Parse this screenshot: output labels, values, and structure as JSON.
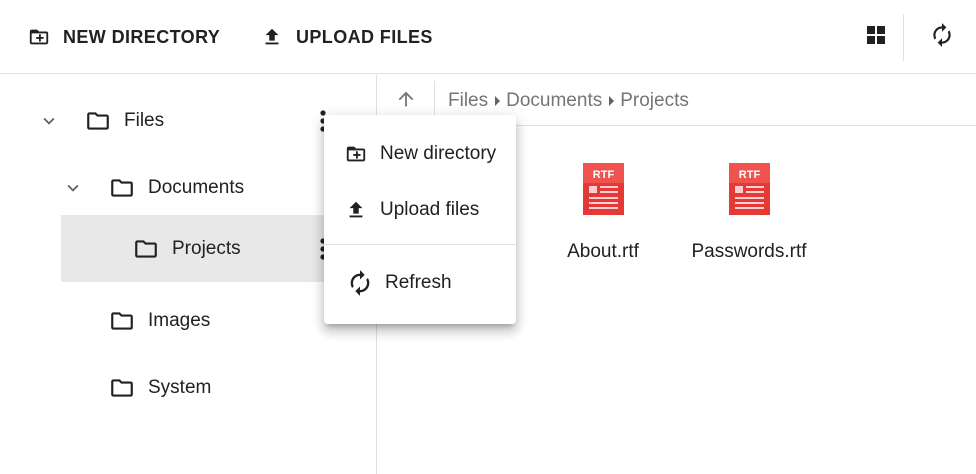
{
  "toolbar": {
    "new_directory_label": "NEW DIRECTORY",
    "upload_files_label": "UPLOAD FILES",
    "grid_view_icon": "grid-view-icon",
    "refresh_icon": "refresh-icon"
  },
  "tree": {
    "items": [
      {
        "label": "Files",
        "expanded": true,
        "icon": "folder-icon"
      },
      {
        "label": "Documents",
        "expanded": true,
        "icon": "folder-icon"
      },
      {
        "label": "Projects",
        "selected": true,
        "icon": "folder-icon"
      },
      {
        "label": "Images",
        "icon": "folder-icon"
      },
      {
        "label": "System",
        "icon": "folder-icon"
      }
    ]
  },
  "breadcrumb": {
    "items": [
      "Files",
      "Documents",
      "Projects"
    ]
  },
  "files": [
    {
      "name": "About.rtf",
      "type_badge": "RTF"
    },
    {
      "name": "Passwords.rtf",
      "type_badge": "RTF"
    }
  ],
  "context_menu": {
    "items": [
      {
        "label": "New directory",
        "icon": "folder-plus-icon"
      },
      {
        "label": "Upload files",
        "icon": "upload-icon"
      },
      {
        "label": "Refresh",
        "icon": "refresh-icon"
      }
    ]
  },
  "colors": {
    "accent_rtf": "#e53935",
    "selected_row": "#e8e8e8",
    "divider": "#e0e0e0"
  }
}
